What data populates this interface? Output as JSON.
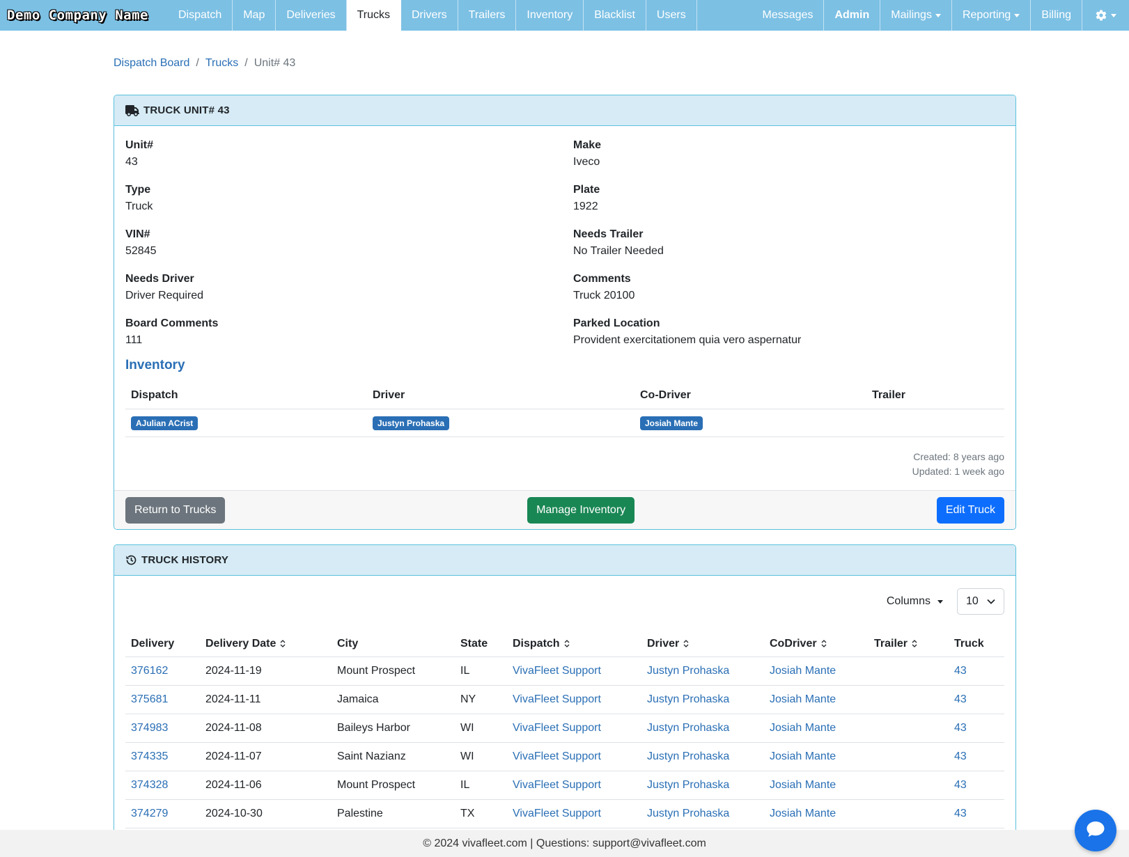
{
  "brand": "Demo Company Name",
  "nav": {
    "left": [
      "Dispatch",
      "Map",
      "Deliveries",
      "Trucks",
      "Drivers",
      "Trailers",
      "Inventory",
      "Blacklist",
      "Users"
    ],
    "active": "Trucks",
    "messages": "Messages",
    "admin": "Admin",
    "mailings": "Mailings",
    "reporting": "Reporting",
    "billing": "Billing"
  },
  "breadcrumb": {
    "item1": "Dispatch Board",
    "item2": "Trucks",
    "current": "Unit# 43"
  },
  "truck": {
    "header": "TRUCK UNIT# 43",
    "fields": [
      {
        "label": "Unit#",
        "value": "43"
      },
      {
        "label": "Make",
        "value": "Iveco"
      },
      {
        "label": "Type",
        "value": "Truck"
      },
      {
        "label": "Plate",
        "value": "1922"
      },
      {
        "label": "VIN#",
        "value": "52845"
      },
      {
        "label": "Needs Trailer",
        "value": "No Trailer Needed"
      },
      {
        "label": "Needs Driver",
        "value": "Driver Required"
      },
      {
        "label": "Comments",
        "value": "Truck 20100"
      },
      {
        "label": "Board Comments",
        "value": "111"
      },
      {
        "label": "Parked Location",
        "value": "Provident exercitationem quia vero aspernatur"
      }
    ],
    "inventory_title": "Inventory",
    "inventory_headers": {
      "dispatch": "Dispatch",
      "driver": "Driver",
      "codriver": "Co-Driver",
      "trailer": "Trailer"
    },
    "inventory_row": {
      "dispatch": "AJulian ACrist",
      "driver": "Justyn Prohaska",
      "codriver": "Josiah Mante",
      "trailer": ""
    },
    "created": "Created: 8 years ago",
    "updated": "Updated: 1 week ago",
    "buttons": {
      "return": "Return to Trucks",
      "manage": "Manage Inventory",
      "edit": "Edit Truck"
    }
  },
  "history": {
    "header": "TRUCK HISTORY",
    "columns_label": "Columns",
    "page_size": "10",
    "headers": [
      "Delivery",
      "Delivery Date",
      "City",
      "State",
      "Dispatch",
      "Driver",
      "CoDriver",
      "Trailer",
      "Truck"
    ],
    "rows": [
      {
        "delivery": "376162",
        "date": "2024-11-19",
        "city": "Mount Prospect",
        "state": "IL",
        "dispatch": "VivaFleet Support",
        "driver": "Justyn Prohaska",
        "codriver": "Josiah Mante",
        "trailer": "",
        "truck": "43"
      },
      {
        "delivery": "375681",
        "date": "2024-11-11",
        "city": "Jamaica",
        "state": "NY",
        "dispatch": "VivaFleet Support",
        "driver": "Justyn Prohaska",
        "codriver": "Josiah Mante",
        "trailer": "",
        "truck": "43"
      },
      {
        "delivery": "374983",
        "date": "2024-11-08",
        "city": "Baileys Harbor",
        "state": "WI",
        "dispatch": "VivaFleet Support",
        "driver": "Justyn Prohaska",
        "codriver": "Josiah Mante",
        "trailer": "",
        "truck": "43"
      },
      {
        "delivery": "374335",
        "date": "2024-11-07",
        "city": "Saint Nazianz",
        "state": "WI",
        "dispatch": "VivaFleet Support",
        "driver": "Justyn Prohaska",
        "codriver": "Josiah Mante",
        "trailer": "",
        "truck": "43"
      },
      {
        "delivery": "374328",
        "date": "2024-11-06",
        "city": "Mount Prospect",
        "state": "IL",
        "dispatch": "VivaFleet Support",
        "driver": "Justyn Prohaska",
        "codriver": "Josiah Mante",
        "trailer": "",
        "truck": "43"
      },
      {
        "delivery": "374279",
        "date": "2024-10-30",
        "city": "Palestine",
        "state": "TX",
        "dispatch": "VivaFleet Support",
        "driver": "Justyn Prohaska",
        "codriver": "Josiah Mante",
        "trailer": "",
        "truck": "43"
      }
    ]
  },
  "footer": "© 2024 vivafleet.com | Questions: support@vivafleet.com",
  "colors": {
    "navbar": "#7cc0e4",
    "card_border": "#5bc0de",
    "card_header": "#d6ebf5",
    "link": "#2a6fb5",
    "badge": "#2a6fb5",
    "btn_secondary": "#6c757d",
    "btn_success": "#198754",
    "btn_primary": "#0d6efd",
    "chat": "#1a73e8"
  },
  "icons": {
    "truck": "truck-icon",
    "history": "history-icon",
    "gear": "gear-icon",
    "chat": "chat-icon",
    "sort": "sort-icon"
  }
}
